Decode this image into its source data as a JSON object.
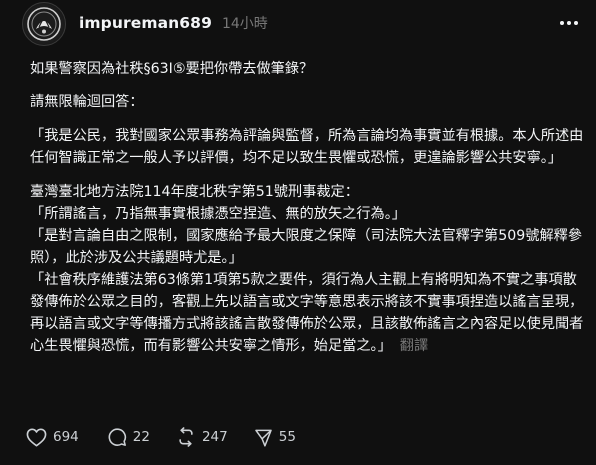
{
  "post": {
    "username": "impureman689",
    "timestamp": "14小時",
    "paragraphs": [
      "如果警察因為社秩§63I⑤要把你帶去做筆錄？",
      "請無限輪迴回答：",
      "「我是公民，我對國家公眾事務為評論與監督，所為言論均為事實並有根據。本人所述由任何智識正常之一般人予以評價，均不足以致生畏懼或恐慌，更遑論影響公共安寧。」",
      "臺灣臺北地方法院114年度北秩字第51號刑事裁定：",
      "「所謂謠言，乃指無事實根據憑空捏造、無的放矢之行為。」",
      "「是對言論自由之限制，國家應給予最大限度之保障（司法院大法官釋字第509號解釋參照），此於涉及公共議題時尤是。」",
      "「社會秩序維護法第63條第1項第5款之要件，須行為人主觀上有將明知為不實之事項散發傳佈於公眾之目的，客觀上先以語言或文字等意思表示將該不實事項捏造以謠言呈現，再以語言或文字等傳播方式將該謠言散發傳佈於公眾，且該散佈謠言之內容足以使見聞者心生畏懼與恐慌，而有影響公共安寧之情形，始足當之。」"
    ],
    "translate_label": "翻譯"
  },
  "actions": {
    "likes": "694",
    "replies": "22",
    "reposts": "247",
    "shares": "55"
  },
  "icons": [
    "avatar-emblem",
    "more-icon",
    "heart-icon",
    "comment-icon",
    "repost-icon",
    "share-icon"
  ],
  "colors": {
    "background": "#101010",
    "text": "#f3f5f7",
    "muted": "#777777"
  }
}
